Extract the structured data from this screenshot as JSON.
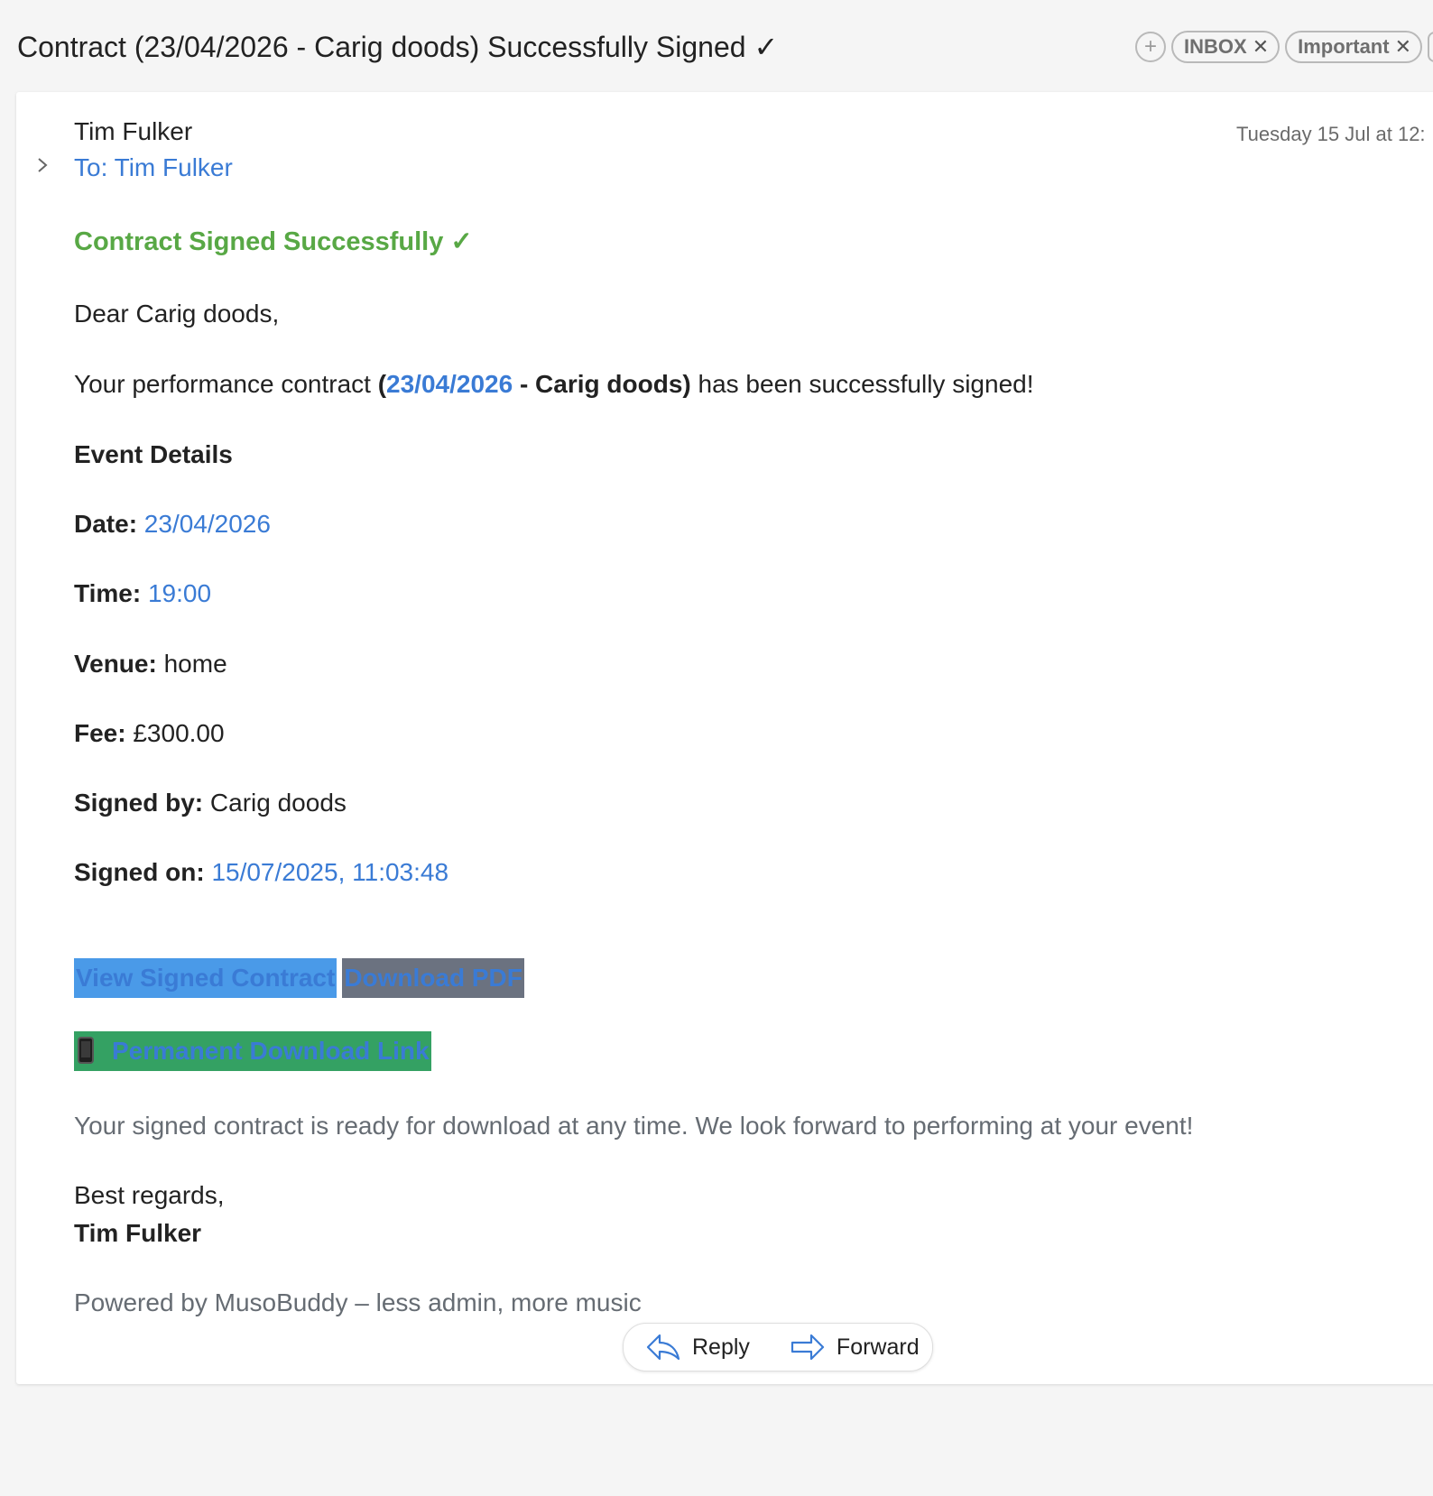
{
  "email": {
    "subject": "Contract (23/04/2026 - Carig doods) Successfully Signed ✓",
    "tags": {
      "add_icon": "plus-icon",
      "items": [
        {
          "label": "INBOX",
          "remove": "✕"
        },
        {
          "label": "Important",
          "remove": "✕"
        }
      ]
    },
    "sender": "Tim Fulker",
    "to": "To: Tim Fulker",
    "date": "Tuesday 15 Jul at 12:",
    "expand_icon": "chevron-right-icon"
  },
  "body": {
    "headline": "Contract Signed Successfully ✓",
    "greeting": "Dear Carig doods,",
    "intro": {
      "prefix": "Your performance contract ",
      "open_paren": "(",
      "date_link": "23/04/2026",
      "client": " - Carig doods)",
      "suffix": " has been successfully signed!"
    },
    "event_details_heading": "Event Details",
    "details": {
      "date_label": "Date:",
      "date_value": "23/04/2026",
      "time_label": "Time:",
      "time_value": "19:00",
      "venue_label": "Venue:",
      "venue_value": "home",
      "fee_label": "Fee:",
      "fee_value": "£300.00",
      "signed_by_label": "Signed by:",
      "signed_by_value": "Carig doods",
      "signed_on_label": "Signed on:",
      "signed_on_value": "15/07/2025, 11:03:48"
    },
    "buttons": {
      "view_contract": "View Signed Contract",
      "download_pdf": "Download PDF",
      "permanent_link": "Permanent Download Link",
      "permanent_icon": "mobile-phone-icon"
    },
    "ready_note": "Your signed contract is ready for download at any time. We look forward to performing at your event!",
    "regards": "Best regards,",
    "signature": "Tim Fulker",
    "powered_by": "Powered by MusoBuddy – less admin, more music"
  },
  "actions": {
    "reply": "Reply",
    "forward": "Forward"
  },
  "colors": {
    "link_blue": "#3a7bd5",
    "headline_green": "#58a845",
    "view_button_bg": "#4a9ae8",
    "pdf_button_bg": "#6b7280",
    "permanent_button_bg": "#34a163"
  }
}
